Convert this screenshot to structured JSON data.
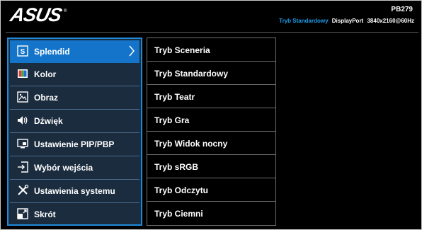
{
  "header": {
    "logo_text": "ASUS",
    "model": "PB279",
    "status_mode": "Tryb Standardowy",
    "status_input": "DisplayPort",
    "status_resolution": "3840x2160@60Hz"
  },
  "menu": {
    "items": [
      {
        "label": "Splendid",
        "icon": "splendid-icon",
        "active": true
      },
      {
        "label": "Kolor",
        "icon": "color-icon"
      },
      {
        "label": "Obraz",
        "icon": "image-icon"
      },
      {
        "label": "Dźwięk",
        "icon": "speaker-icon"
      },
      {
        "label": "Ustawienie PIP/PBP",
        "icon": "pip-icon"
      },
      {
        "label": "Wybór wejścia",
        "icon": "input-select-icon"
      },
      {
        "label": "Ustawienia systemu",
        "icon": "system-settings-icon"
      },
      {
        "label": "Skrót",
        "icon": "shortcut-icon"
      }
    ]
  },
  "submenu": {
    "items": [
      {
        "label": "Tryb Sceneria"
      },
      {
        "label": "Tryb Standardowy"
      },
      {
        "label": "Tryb Teatr"
      },
      {
        "label": "Tryb Gra"
      },
      {
        "label": "Tryb Widok nocny"
      },
      {
        "label": "Tryb sRGB"
      },
      {
        "label": "Tryb Odczytu"
      },
      {
        "label": "Tryb Ciemni"
      }
    ]
  },
  "colors": {
    "accent": "#1474c9",
    "status_highlight": "#1e9be9",
    "menu_background": "#1b2c3f",
    "background": "#000000"
  }
}
